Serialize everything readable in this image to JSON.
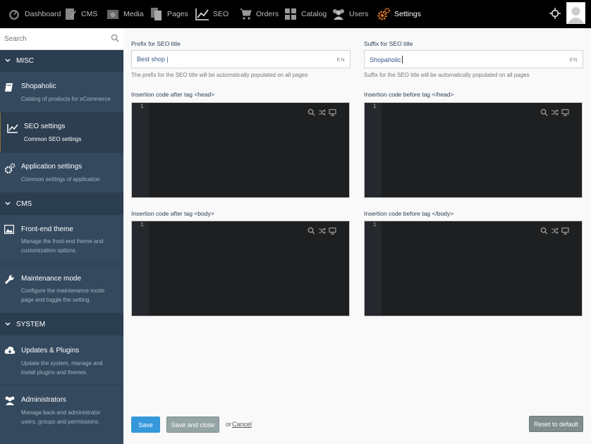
{
  "topnav": {
    "items": [
      {
        "label": "Dashboard",
        "icon": "dashboard-icon"
      },
      {
        "label": "CMS",
        "icon": "cms-icon"
      },
      {
        "label": "Media",
        "icon": "media-icon"
      },
      {
        "label": "Pages",
        "icon": "pages-icon"
      },
      {
        "label": "SEO",
        "icon": "seo-icon"
      },
      {
        "label": "Orders",
        "icon": "cart-icon"
      },
      {
        "label": "Catalog",
        "icon": "catalog-icon"
      },
      {
        "label": "Users",
        "icon": "users-icon"
      },
      {
        "label": "Settings",
        "icon": "settings-icon",
        "active": true
      }
    ],
    "locate_icon": "crosshair-icon",
    "accent_color": "#e67e22"
  },
  "sidebar": {
    "search_placeholder": "Search",
    "sections": [
      {
        "label": "MISC"
      },
      {
        "label": "CMS"
      },
      {
        "label": "SYSTEM"
      }
    ],
    "items": [
      {
        "title": "Shopaholic",
        "desc": "Catalog of products for eCommerce",
        "icon": "book-icon"
      },
      {
        "title": "SEO settings",
        "desc": "Common SEO settings",
        "icon": "chart-line-icon",
        "active": true
      },
      {
        "title": "Application settings",
        "desc": "Common settings of application",
        "icon": "cogs-icon"
      },
      {
        "title": "Front-end theme",
        "desc": "Manage the front-end theme and customization options.",
        "icon": "picture-icon"
      },
      {
        "title": "Maintenance mode",
        "desc": "Configure the maintenance mode page and toggle the setting.",
        "icon": "wrench-icon"
      },
      {
        "title": "Updates & Plugins",
        "desc": "Update the system, manage and install plugins and themes.",
        "icon": "cloud-download-icon"
      },
      {
        "title": "Administrators",
        "desc": "Manage back-end administrator users, groups and permissions.",
        "icon": "users-icon"
      }
    ]
  },
  "form": {
    "prefix": {
      "label": "Prefix for SEO title",
      "value": "Best shop |",
      "lang": "EN",
      "help": "The prefix for the SEO title will be automatically populated on all pages"
    },
    "suffix": {
      "label": "Suffix for SEO title",
      "value": "Shopaholic",
      "lang": "EN",
      "help": "Suffix for the SEO title will be automatically populated on all pages"
    },
    "editors": [
      {
        "label": "Insertion code after tag <head>",
        "line": "1"
      },
      {
        "label": "Insertion code before tag </head>",
        "line": "1"
      },
      {
        "label": "Insertion code after tag <body>",
        "line": "1"
      },
      {
        "label": "Insertion code before tag </body>",
        "line": "1"
      }
    ]
  },
  "actions": {
    "save": "Save",
    "save_close": "Save and close",
    "or": "or",
    "cancel": "Cancel",
    "reset": "Reset to default"
  }
}
